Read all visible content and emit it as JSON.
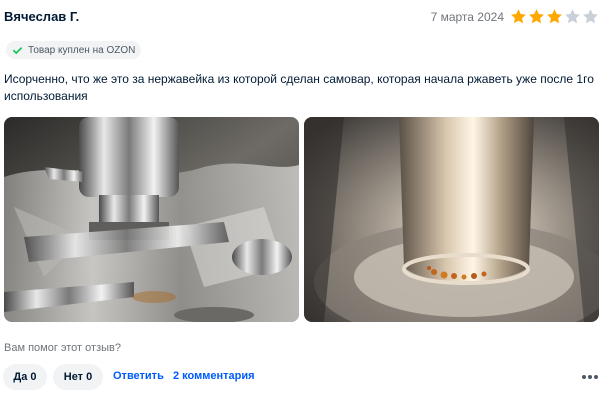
{
  "review": {
    "author": "Вячеслав Г.",
    "date": "7 марта 2024",
    "rating": 3,
    "rating_max": 5,
    "badge": "Товар куплен на OZON",
    "text": "Исорченно, что же это за нержавейка из которой сделан самовар, которая начала ржаветь уже после 1го использования"
  },
  "footer": {
    "helpful_question": "Вам помог этот отзыв?",
    "yes_label": "Да 0",
    "no_label": "Нет 0",
    "reply_label": "Ответить",
    "comments_label": "2 комментария"
  },
  "icons": {
    "star": "star-icon",
    "check": "check-icon",
    "more": "more-dots-icon"
  },
  "colors": {
    "star_filled": "#ffa800",
    "star_empty": "#c9d0d8",
    "link": "#005bff",
    "badge_check": "#10c44c"
  }
}
